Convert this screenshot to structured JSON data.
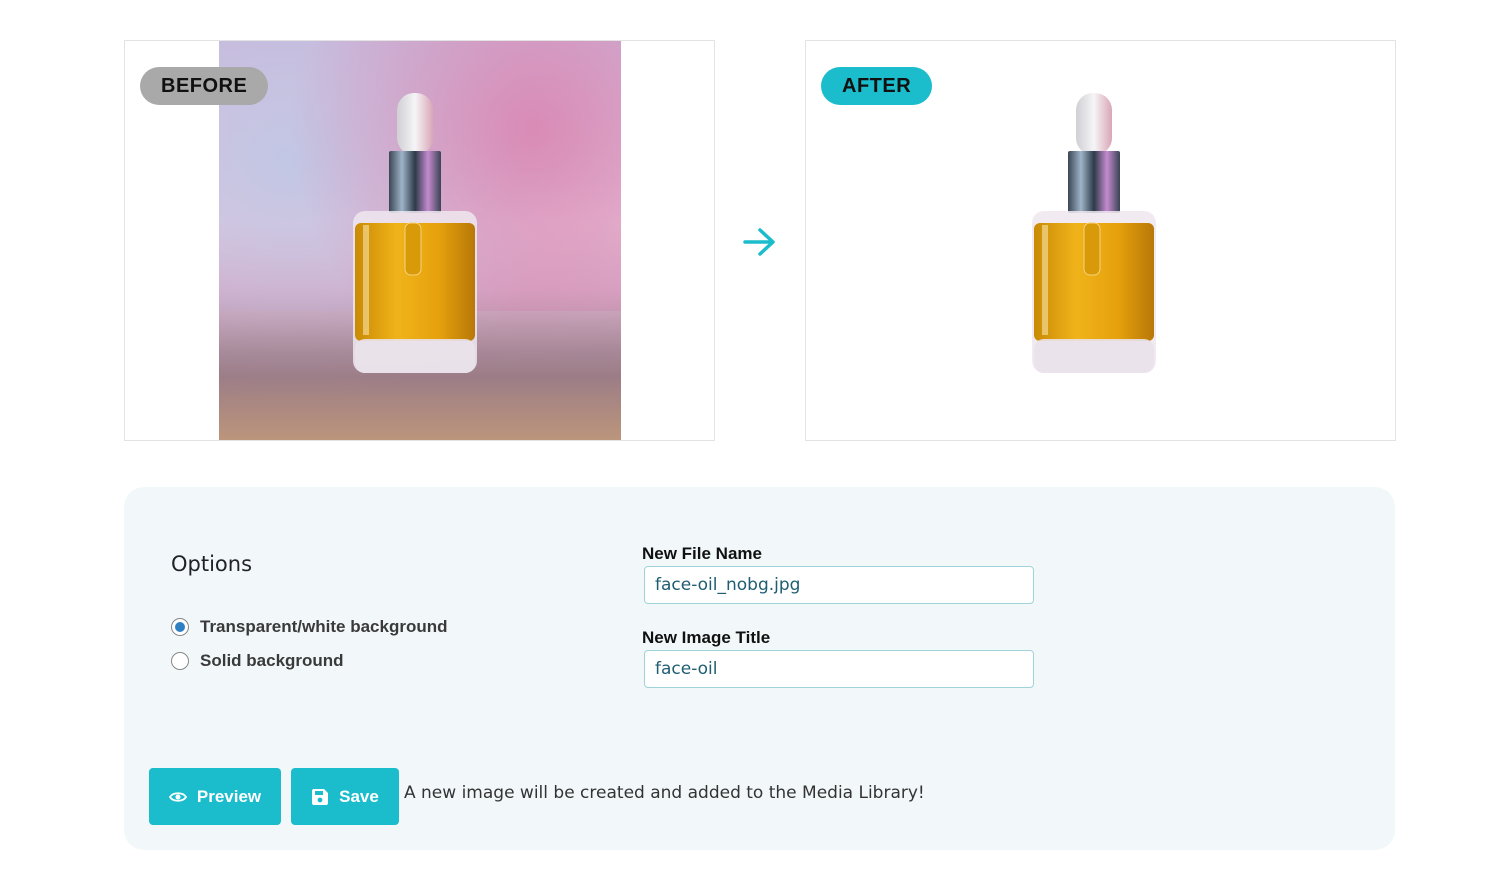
{
  "compare": {
    "before_label": "BEFORE",
    "after_label": "AFTER"
  },
  "options": {
    "title": "Options",
    "radios": [
      {
        "label": "Transparent/white background",
        "checked": true
      },
      {
        "label": "Solid background",
        "checked": false
      }
    ],
    "file_name_label": "New File Name",
    "file_name_value": "face-oil_nobg.jpg",
    "image_title_label": "New Image Title",
    "image_title_value": "face-oil"
  },
  "actions": {
    "preview_label": "Preview",
    "save_label": "Save",
    "note": "A new image will be created and added to the Media Library!"
  },
  "colors": {
    "accent": "#1bbccb",
    "before_badge": "#a9a9a9",
    "card_bg": "#f2f8fa",
    "radio_checked": "#2f80c3"
  },
  "icons": {
    "arrow": "arrow-right-icon",
    "preview": "eye-icon",
    "save": "floppy-disk-icon"
  }
}
